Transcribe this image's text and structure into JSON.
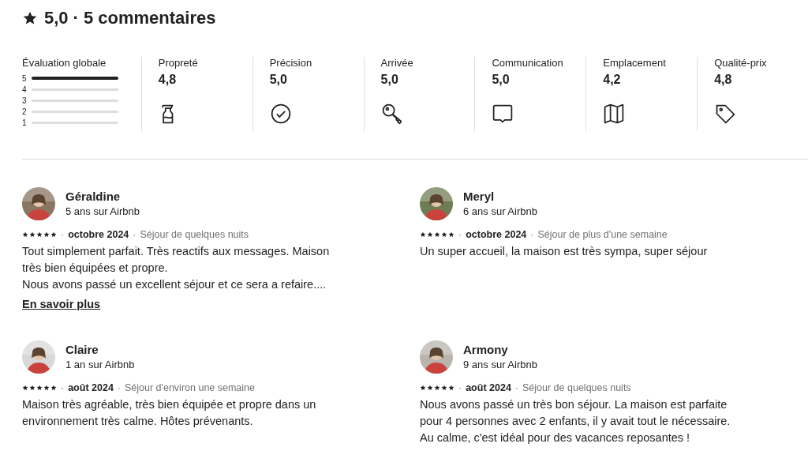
{
  "header": {
    "rating": "5,0",
    "separator": "·",
    "count": "5 commentaires"
  },
  "overall": {
    "label": "Évaluation globale",
    "bars": [
      {
        "label": "5",
        "level": 1.0
      },
      {
        "label": "4",
        "level": 0
      },
      {
        "label": "3",
        "level": 0
      },
      {
        "label": "2",
        "level": 0
      },
      {
        "label": "1",
        "level": 0
      }
    ]
  },
  "categories": [
    {
      "label": "Propreté",
      "value": "4,8",
      "kind": "spray"
    },
    {
      "label": "Précision",
      "value": "5,0",
      "kind": "check"
    },
    {
      "label": "Arrivée",
      "value": "5,0",
      "kind": "key"
    },
    {
      "label": "Communication",
      "value": "5,0",
      "kind": "chat"
    },
    {
      "label": "Emplacement",
      "value": "4,2",
      "kind": "map"
    },
    {
      "label": "Qualité-prix",
      "value": "4,8",
      "kind": "tag"
    }
  ],
  "reviews": [
    {
      "name": "Géraldine",
      "tenure": "5 ans sur Airbnb",
      "stars": 5,
      "date": "octobre 2024",
      "stay": "Séjour de quelques nuits",
      "text": "Tout simplement parfait. Très reactifs aux messages. Maison très bien équipées et propre.\nNous avons passé un excellent séjour et ce sera a refaire....",
      "more": "En savoir plus",
      "separator_1": "·",
      "separator_2": "·"
    },
    {
      "name": "Meryl",
      "tenure": "6 ans sur Airbnb",
      "stars": 5,
      "date": "octobre 2024",
      "stay": "Séjour de plus d'une semaine",
      "text": "Un super accueil, la maison est très sympa, super séjour",
      "separator_1": "·",
      "separator_2": "·"
    },
    {
      "name": "Claire",
      "tenure": "1 an sur Airbnb",
      "stars": 5,
      "date": "août 2024",
      "stay": "Séjour d'environ une semaine",
      "text": "Maison très agréable, très bien équipée et propre dans un environnement très calme. Hôtes prévenants.",
      "separator_1": "·",
      "separator_2": "·"
    },
    {
      "name": "Armony",
      "tenure": "9 ans sur Airbnb",
      "stars": 5,
      "date": "août 2024",
      "stay": "Séjour de quelques nuits",
      "text": "Nous avons passé un très bon séjour. La maison est parfaite pour 4 personnes avec 2 enfants, il y avait tout le nécessaire.\nAu calme, c'est idéal pour des vacances reposantes !",
      "separator_1": "·",
      "separator_2": "·"
    }
  ]
}
